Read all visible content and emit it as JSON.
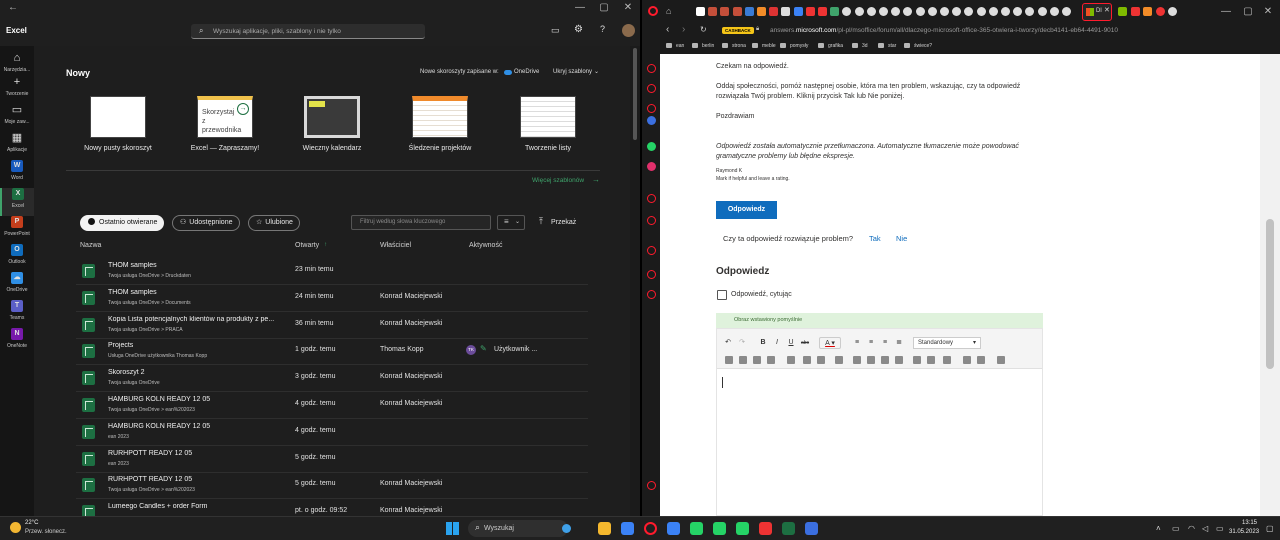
{
  "excel": {
    "app_name": "Excel",
    "search_placeholder": "Wyszukaj aplikacje, pliki, szablony i nie tylko",
    "rail": [
      {
        "label": "Narzędzia...",
        "icon": "home-icon"
      },
      {
        "label": "Tworzenie",
        "icon": "plus-circle-icon"
      },
      {
        "label": "Moje zaw...",
        "icon": "folder-icon"
      },
      {
        "label": "Aplikacje",
        "icon": "apps-grid-icon"
      },
      {
        "label": "Word",
        "icon": "word-icon"
      },
      {
        "label": "Excel",
        "icon": "excel-icon"
      },
      {
        "label": "PowerPoint",
        "icon": "powerpoint-icon"
      },
      {
        "label": "Outlook",
        "icon": "outlook-icon"
      },
      {
        "label": "OneDrive",
        "icon": "onedrive-icon"
      },
      {
        "label": "Teams",
        "icon": "teams-icon"
      },
      {
        "label": "OneNote",
        "icon": "onenote-icon"
      }
    ],
    "new_section": {
      "title": "Nowy",
      "save_to_label": "Nowe skoroszyty zapisane w:",
      "save_to_target": "OneDrive",
      "hide_templates": "Ukryj szablony",
      "more_templates": "Więcej szablonów",
      "templates": [
        {
          "label": "Nowy pusty skoroszyt",
          "thumb_text": ""
        },
        {
          "label": "Excel — Zapraszamy!",
          "thumb_text": "Skorzystaj z przewodnika"
        },
        {
          "label": "Wieczny kalendarz",
          "thumb_text": ""
        },
        {
          "label": "Śledzenie projektów",
          "thumb_text": ""
        },
        {
          "label": "Tworzenie listy",
          "thumb_text": ""
        }
      ]
    },
    "filters": {
      "recent": "Ostatnio otwierane",
      "shared": "Udostępnione",
      "favorites": "Ulubione",
      "keyword_placeholder": "Filtruj według słowa kluczowego",
      "browse": "Przekaż"
    },
    "columns": {
      "name": "Nazwa",
      "opened": "Otwarty",
      "owner": "Właściciel",
      "activity": "Aktywność"
    },
    "files": [
      {
        "name": "THOM samples",
        "path": "Twoja usługa OneDrive > Druckdaten",
        "opened": "23 min temu",
        "owner": "",
        "activity": ""
      },
      {
        "name": "THOM samples",
        "path": "Twoja usługa OneDrive > Documents",
        "opened": "24 min temu",
        "owner": "Konrad Maciejewski",
        "activity": ""
      },
      {
        "name": "Kopia Lista potencjalnych klientów na produkty z pe...",
        "path": "Twoja usługa OneDrive > PRACA",
        "opened": "36 min temu",
        "owner": "Konrad Maciejewski",
        "activity": ""
      },
      {
        "name": "Projects",
        "path": "Usługa OneDrive użytkownika Thomas Kopp",
        "opened": "1 godz. temu",
        "owner": "Thomas Kopp",
        "activity": "Użytkownik ..."
      },
      {
        "name": "Skoroszyt 2",
        "path": "Twoja usługa OneDrive",
        "opened": "3 godz. temu",
        "owner": "Konrad Maciejewski",
        "activity": ""
      },
      {
        "name": "HAMBURG KOLN READY 12 05",
        "path": "Twoja usługa OneDrive > ean%202023",
        "opened": "4 godz. temu",
        "owner": "Konrad Maciejewski",
        "activity": ""
      },
      {
        "name": "HAMBURG KOLN READY 12 05",
        "path": "ean 2023",
        "opened": "4 godz. temu",
        "owner": "",
        "activity": ""
      },
      {
        "name": "RURHPOTT READY 12 05",
        "path": "ean 2023",
        "opened": "5 godz. temu",
        "owner": "",
        "activity": ""
      },
      {
        "name": "RURHPOTT READY 12 05",
        "path": "Twoja usługa OneDrive > ean%202023",
        "opened": "5 godz. temu",
        "owner": "Konrad Maciejewski",
        "activity": ""
      },
      {
        "name": "Lumeego Candles + order Form",
        "path": "",
        "opened": "pt. o godz. 09:52",
        "owner": "Konrad Maciejewski",
        "activity": ""
      }
    ],
    "activity_avatar": "TK"
  },
  "browser": {
    "active_tab_label": "Dl",
    "cashback_badge": "CASHBACK",
    "url_prefix": "answers.",
    "url_domain": "microsoft.com",
    "url_path": "/pl-pl/msoffice/forum/all/dlaczego-microsoft-office-365-otwiera-i-tworzy/decb4141-eb64-4491-9010",
    "bookmarks": [
      "ean",
      "berlin",
      "strona",
      "meble",
      "pomysły",
      "grafika",
      "3d",
      "star",
      "świece?"
    ],
    "page": {
      "waiting": "Czekam na odpowiedź.",
      "community_line1": "Oddaj społeczności, pomóż następnej osobie, która ma ten problem, wskazując, czy ta odpowiedź",
      "community_line2": "rozwiązała Twój problem. Kliknij przycisk Tak lub Nie poniżej.",
      "greeting": "Pozdrawiam",
      "mt_line1": "Odpowiedź została automatycznie przetłumaczona. Automatyczne tłumaczenie może powodować",
      "mt_line2": "gramatyczne problemy lub błędne ekspresje.",
      "author": "Raymond K",
      "signature": "Mark if helpful and leave a rating.",
      "reply_button": "Odpowiedz",
      "helpful_question": "Czy ta odpowiedź rozwiązuje problem?",
      "yes": "Tak",
      "no": "Nie",
      "reply_heading": "Odpowiedz",
      "quote_label": "Odpowiedź, cytując",
      "banner": "Obraz wstawiony pomyślnie",
      "format_select": "Standardowy"
    }
  },
  "taskbar": {
    "weather_temp": "22°C",
    "weather_desc": "Przew. słonecz.",
    "search": "Wyszukaj",
    "time": "13:15",
    "date": "31.05.2023"
  },
  "colors": {
    "excel_green": "#1d6f42",
    "link_blue": "#0f6cbd",
    "opera_red": "#ff1b2d"
  }
}
